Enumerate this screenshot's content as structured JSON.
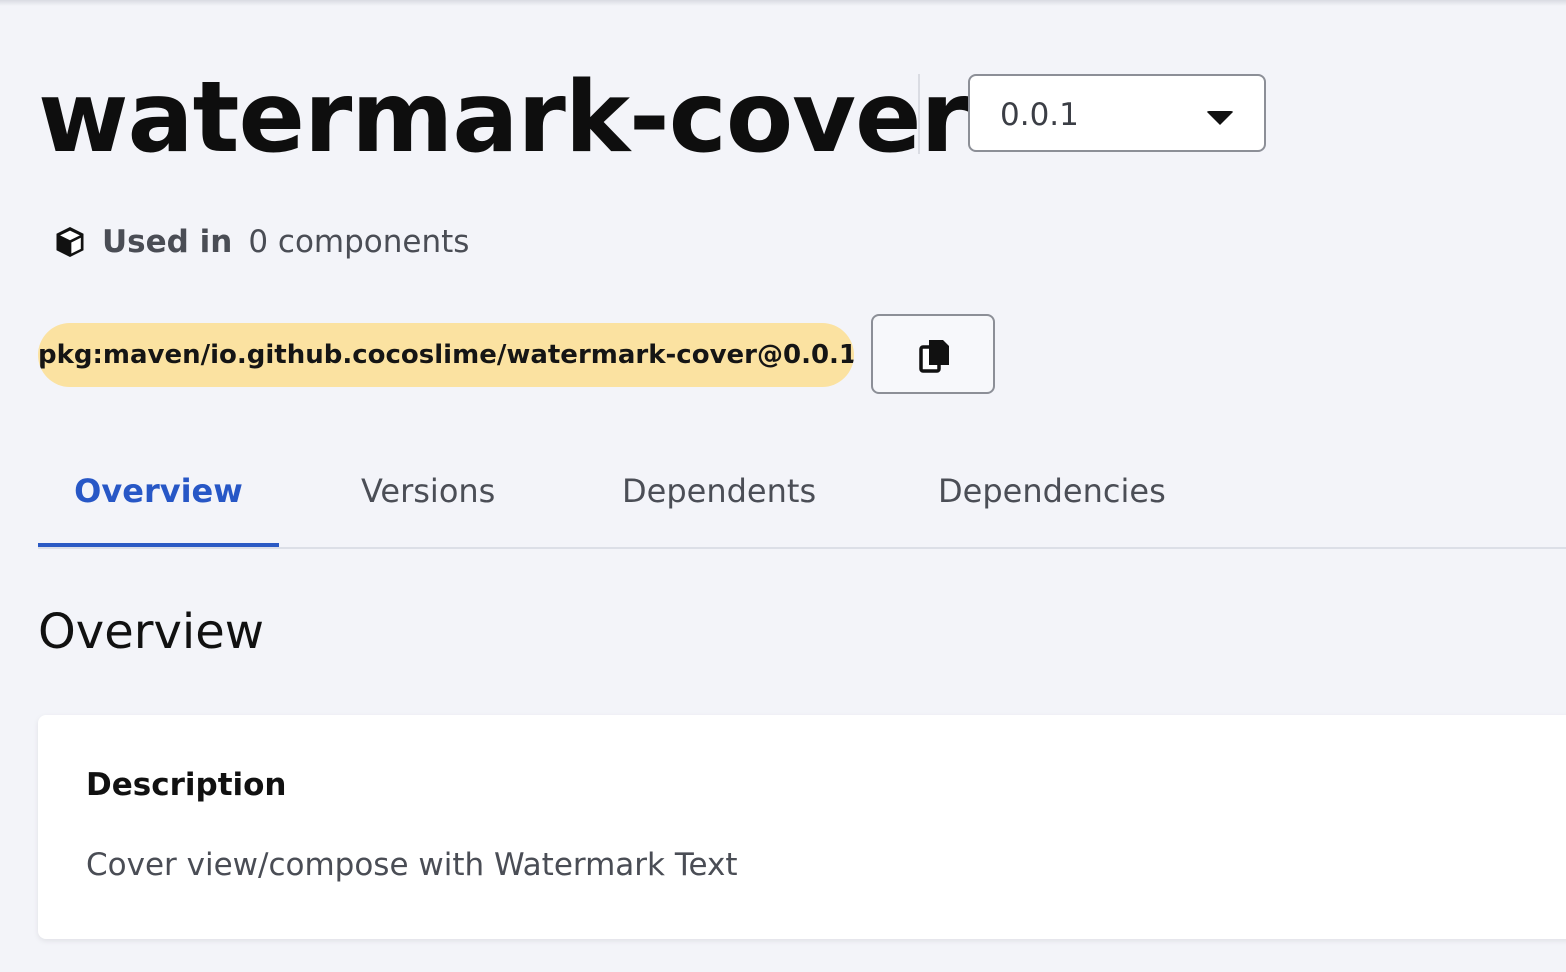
{
  "header": {
    "title": "watermark-cover",
    "version_selected": "0.0.1"
  },
  "usage": {
    "label": "Used in",
    "value": "0 components",
    "icon": "cube-icon"
  },
  "purl": {
    "text": "pkg:maven/io.github.cocoslime/watermark-cover@0.0.1",
    "copy_icon": "copy-icon"
  },
  "tabs": [
    {
      "label": "Overview",
      "active": true
    },
    {
      "label": "Versions",
      "active": false
    },
    {
      "label": "Dependents",
      "active": false
    },
    {
      "label": "Dependencies",
      "active": false
    }
  ],
  "overview": {
    "section_title": "Overview",
    "description_heading": "Description",
    "description_text": "Cover view/compose with Watermark Text"
  },
  "colors": {
    "background": "#f3f4f9",
    "accent": "#2757c6",
    "purl_pill": "#fbe2a1",
    "card": "#ffffff"
  }
}
